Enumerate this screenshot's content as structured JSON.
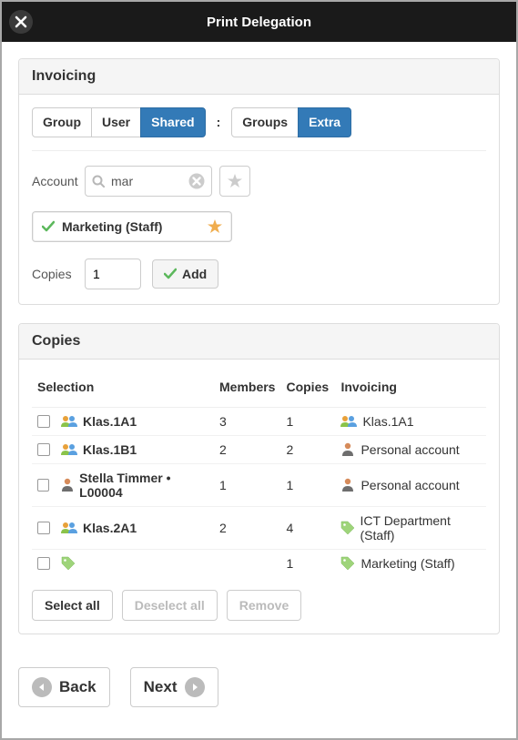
{
  "dialog": {
    "title": "Print Delegation"
  },
  "invoicing": {
    "heading": "Invoicing",
    "tabs1": {
      "group": "Group",
      "user": "User",
      "shared": "Shared"
    },
    "tabs2": {
      "groups": "Groups",
      "extra": "Extra"
    },
    "colon": ":",
    "account_label": "Account",
    "search_value": "mar",
    "chip_label": "Marketing (Staff)",
    "copies_label": "Copies",
    "copies_value": "1",
    "add_label": "Add"
  },
  "copies_panel": {
    "heading": "Copies",
    "columns": {
      "selection": "Selection",
      "members": "Members",
      "copies": "Copies",
      "invoicing": "Invoicing"
    },
    "rows": [
      {
        "icon": "group",
        "name": "Klas.1A1",
        "members": "3",
        "copies": "1",
        "inv_icon": "group",
        "inv_text": "Klas.1A1"
      },
      {
        "icon": "group",
        "name": "Klas.1B1",
        "members": "2",
        "copies": "2",
        "inv_icon": "person",
        "inv_text": "Personal account"
      },
      {
        "icon": "person",
        "name": "Stella Timmer • L00004",
        "members": "1",
        "copies": "1",
        "inv_icon": "person",
        "inv_text": "Personal account"
      },
      {
        "icon": "group",
        "name": "Klas.2A1",
        "members": "2",
        "copies": "4",
        "inv_icon": "tag",
        "inv_text": "ICT Department (Staff)"
      },
      {
        "icon": "tag",
        "name": "",
        "members": "",
        "copies": "1",
        "inv_icon": "tag",
        "inv_text": "Marketing (Staff)"
      }
    ],
    "select_all": "Select all",
    "deselect_all": "Deselect all",
    "remove": "Remove"
  },
  "footer": {
    "back": "Back",
    "next": "Next"
  }
}
